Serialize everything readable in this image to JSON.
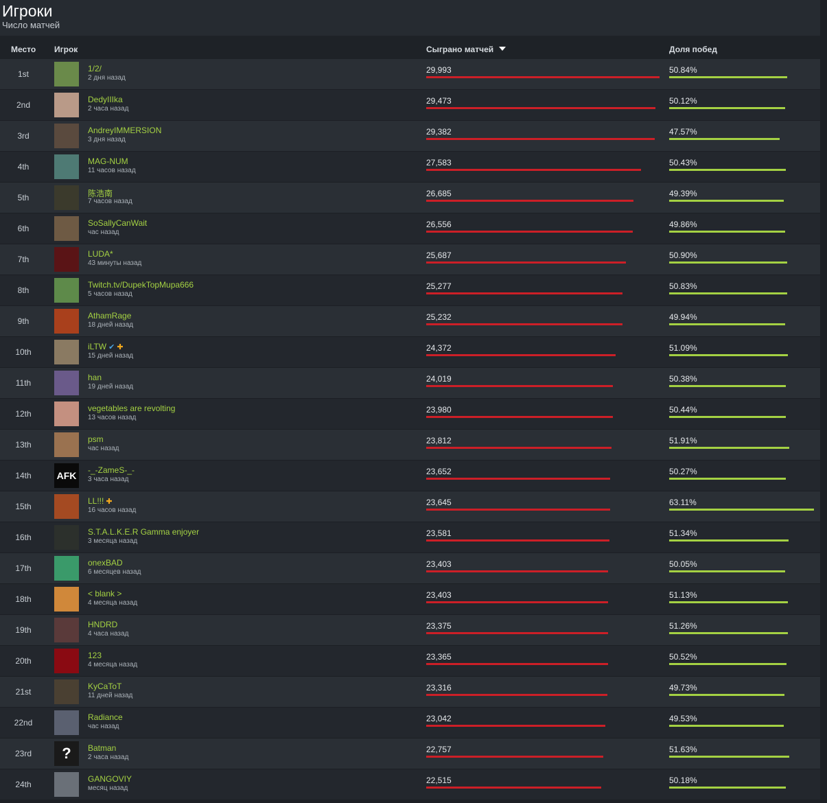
{
  "page": {
    "title": "Игроки",
    "subtitle": "Число матчей"
  },
  "columns": {
    "rank": "Место",
    "player": "Игрок",
    "matches": "Сыграно матчей",
    "winrate": "Доля побед"
  },
  "colors": {
    "matches_bar": "#cc1f27",
    "winrate_bar": "#a4d143",
    "player_name": "#a4d143"
  },
  "players": [
    {
      "rank": "1st",
      "name": "1/2/",
      "last_seen": "2 дня назад",
      "matches": "29,993",
      "winrate": "50.84%",
      "avatar_icon": "landscape-avatar-icon",
      "avatar_color": "#6a8a4a"
    },
    {
      "rank": "2nd",
      "name": "DedyIIIka",
      "last_seen": "2 часа назад",
      "matches": "29,473",
      "winrate": "50.12%",
      "avatar_icon": "portrait-avatar-icon",
      "avatar_color": "#b99a88"
    },
    {
      "rank": "3rd",
      "name": "AndreyIMMERSION",
      "last_seen": "3 дня назад",
      "matches": "29,382",
      "winrate": "47.57%",
      "avatar_icon": "vehicle-avatar-icon",
      "avatar_color": "#5a4a3e"
    },
    {
      "rank": "4th",
      "name": "MAG-NUM",
      "last_seen": "11 часов назад",
      "matches": "27,583",
      "winrate": "50.43%",
      "avatar_icon": "hero-avatar-icon",
      "avatar_color": "#4e7a74"
    },
    {
      "rank": "5th",
      "name": "陈浩南",
      "last_seen": "7 часов назад",
      "matches": "26,685",
      "winrate": "49.39%",
      "avatar_icon": "person-avatar-icon",
      "avatar_color": "#3b3a2c"
    },
    {
      "rank": "6th",
      "name": "SoSallyCanWait",
      "last_seen": "час назад",
      "matches": "26,556",
      "winrate": "49.86%",
      "avatar_icon": "face-avatar-icon",
      "avatar_color": "#6e5a44"
    },
    {
      "rank": "7th",
      "name": "LUDA*",
      "last_seen": "43 минуты назад",
      "matches": "25,687",
      "winrate": "50.90%",
      "avatar_icon": "boots-avatar-icon",
      "avatar_color": "#5a1416"
    },
    {
      "rank": "8th",
      "name": "Twitch.tv/DupekTopMupa666",
      "last_seen": "5 часов назад",
      "matches": "25,277",
      "winrate": "50.83%",
      "avatar_icon": "pyramid-eye-avatar-icon",
      "avatar_color": "#5e8a4a"
    },
    {
      "rank": "9th",
      "name": "AthamRage",
      "last_seen": "18 дней назад",
      "matches": "25,232",
      "winrate": "49.94%",
      "avatar_icon": "demon-avatar-icon",
      "avatar_color": "#a9401c"
    },
    {
      "rank": "10th",
      "name": "iLTW",
      "last_seen": "15 дней назад",
      "matches": "24,372",
      "winrate": "51.09%",
      "avatar_icon": "crowd-avatar-icon",
      "avatar_color": "#8a7a62",
      "verified_icon": "✔",
      "plus_icon": "✚"
    },
    {
      "rank": "11th",
      "name": "han",
      "last_seen": "19 дней назад",
      "matches": "24,019",
      "winrate": "50.38%",
      "avatar_icon": "elf-avatar-icon",
      "avatar_color": "#6a5a8a"
    },
    {
      "rank": "12th",
      "name": "vegetables are revolting",
      "last_seen": "13 часов назад",
      "matches": "23,980",
      "winrate": "50.44%",
      "avatar_icon": "anime-avatar-icon",
      "avatar_color": "#c49080"
    },
    {
      "rank": "13th",
      "name": "psm",
      "last_seen": "час назад",
      "matches": "23,812",
      "winrate": "51.91%",
      "avatar_icon": "cartoon-avatar-icon",
      "avatar_color": "#9a7250"
    },
    {
      "rank": "14th",
      "name": "-_-ZameS-_-",
      "last_seen": "3 часа назад",
      "matches": "23,652",
      "winrate": "50.27%",
      "avatar_icon": "afk-avatar-icon",
      "avatar_color": "#0a0a0a",
      "avatar_text": "AFK"
    },
    {
      "rank": "15th",
      "name": "LL!!!",
      "last_seen": "16 часов назад",
      "matches": "23,645",
      "winrate": "63.11%",
      "avatar_icon": "red-panda-avatar-icon",
      "avatar_color": "#a44a22",
      "plus_icon": "✚"
    },
    {
      "rank": "16th",
      "name": "S.T.A.L.K.E.R Gamma enjoyer",
      "last_seen": "3 месяца назад",
      "matches": "23,581",
      "winrate": "51.34%",
      "avatar_icon": "stalker-avatar-icon",
      "avatar_color": "#2c302c"
    },
    {
      "rank": "17th",
      "name": "onexBAD",
      "last_seen": "6 месяцев назад",
      "matches": "23,403",
      "winrate": "50.05%",
      "avatar_icon": "grin-avatar-icon",
      "avatar_color": "#3a9a6a"
    },
    {
      "rank": "18th",
      "name": "< blank >",
      "last_seen": "4 месяца назад",
      "matches": "23,403",
      "winrate": "51.13%",
      "avatar_icon": "dragon-avatar-icon",
      "avatar_color": "#d0883a"
    },
    {
      "rank": "19th",
      "name": "HNDRD",
      "last_seen": "4 часа назад",
      "matches": "23,375",
      "winrate": "51.26%",
      "avatar_icon": "girl-avatar-icon",
      "avatar_color": "#5a3a3a"
    },
    {
      "rank": "20th",
      "name": "123",
      "last_seen": "4 месяца назад",
      "matches": "23,365",
      "winrate": "50.52%",
      "avatar_icon": "flames-avatar-icon",
      "avatar_color": "#8a0a12"
    },
    {
      "rank": "21st",
      "name": "KyCaToT",
      "last_seen": "11 дней назад",
      "matches": "23,316",
      "winrate": "49.73%",
      "avatar_icon": "warrior-avatar-icon",
      "avatar_color": "#4a4032"
    },
    {
      "rank": "22nd",
      "name": "Radiance",
      "last_seen": "час назад",
      "matches": "23,042",
      "winrate": "49.53%",
      "avatar_icon": "hand-sign-avatar-icon",
      "avatar_color": "#5a6070"
    },
    {
      "rank": "23rd",
      "name": "Batman",
      "last_seen": "2 часа назад",
      "matches": "22,757",
      "winrate": "51.63%",
      "avatar_icon": "question-avatar-icon",
      "avatar_color": "#1a1a1a",
      "avatar_text": "?"
    },
    {
      "rank": "24th",
      "name": "GANGOVIY",
      "last_seen": "месяц назад",
      "matches": "22,515",
      "winrate": "50.18%",
      "avatar_icon": "silver-hair-avatar-icon",
      "avatar_color": "#6a7078"
    }
  ]
}
